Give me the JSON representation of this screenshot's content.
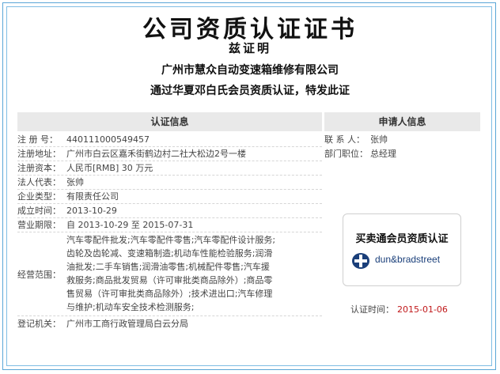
{
  "header": {
    "title": "公司资质认证证书",
    "subtitle": "兹证明",
    "company": "广州市慧众自动变速箱维修有限公司",
    "statement": "通过华夏邓白氏会员资质认证，特发此证"
  },
  "left_panel": {
    "heading": "认证信息",
    "reg_no": {
      "label": "注 册 号：",
      "value": "440111000549457"
    },
    "address": {
      "label": "注册地址：",
      "value": "广州市白云区嘉禾街鹤边村二社大松边2号一楼"
    },
    "capital": {
      "label": "注册资本：",
      "value": "人民币[RMB] 30 万元"
    },
    "legal": {
      "label": "法人代表：",
      "value": "张帅"
    },
    "type": {
      "label": "企业类型：",
      "value": "有限责任公司"
    },
    "founded": {
      "label": "成立时间：",
      "value": "2013-10-29"
    },
    "term": {
      "label": "营业期限：",
      "value": "自 2013-10-29 至 2015-07-31"
    },
    "scope": {
      "label": "经营范围：",
      "lines": [
        "汽车零配件批发;汽车零配件零售;汽车零配件设计服务;",
        "齿轮及齿轮减、变速箱制造;机动车性能检验服务;润滑",
        "油批发;二手车销售;润滑油零售;机械配件零售;汽车援",
        "救服务;商品批发贸易（许可审批类商品除外）;商品零",
        "售贸易（许可审批类商品除外）;技术进出口;汽车修理",
        "与维护;机动车安全技术检测服务;"
      ]
    },
    "authority": {
      "label": "登记机关：",
      "value": "广州市工商行政管理局白云分局"
    }
  },
  "right_panel": {
    "heading": "申请人信息",
    "contact": {
      "label": "联 系 人：",
      "value": "张帅"
    },
    "position": {
      "label": "部门职位：",
      "value": "总经理"
    },
    "badge": {
      "title": "买卖通会员资质认证",
      "logo_text": "dun&bradstreet",
      "logo_icon": "huaxia-credit-logo"
    },
    "cert_time": {
      "label": "认证时间：",
      "value": "2015-01-06"
    }
  },
  "colors": {
    "border": "#5aa6d6",
    "header_bg": "#e9e9e9",
    "date_red": "#c0181a"
  }
}
